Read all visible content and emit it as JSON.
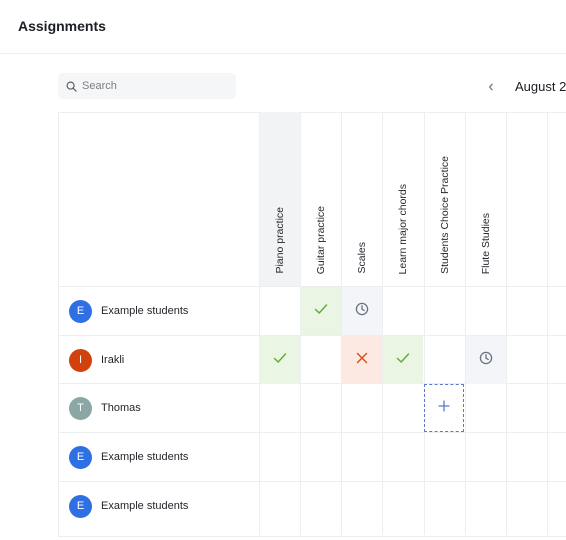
{
  "header": {
    "title": "Assignments"
  },
  "search": {
    "placeholder": "Search",
    "value": ""
  },
  "period": {
    "label": "August 2"
  },
  "assignments": [
    {
      "label": "Piano practice"
    },
    {
      "label": "Guitar practice"
    },
    {
      "label": "Scales"
    },
    {
      "label": "Learn major chords"
    },
    {
      "label": "Students Choice Practice"
    },
    {
      "label": "Flute Studies"
    }
  ],
  "students": [
    {
      "name": "Example students",
      "initial": "E",
      "color": "#2f6fe4"
    },
    {
      "name": "Irakli",
      "initial": "I",
      "color": "#d2410c"
    },
    {
      "name": "Thomas",
      "initial": "T",
      "color": "#8aa7a6"
    },
    {
      "name": "Example students",
      "initial": "E",
      "color": "#2f6fe4"
    },
    {
      "name": "Example students",
      "initial": "E",
      "color": "#2f6fe4"
    }
  ],
  "status_colors": {
    "done": "#5fae3a",
    "missed": "#d9531f",
    "pending": "#6b7280",
    "add": "#5a78d1"
  }
}
